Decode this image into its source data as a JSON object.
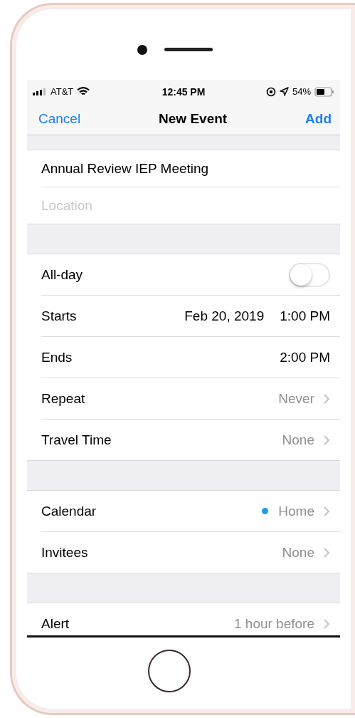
{
  "status_bar": {
    "carrier": "AT&T",
    "time": "12:45 PM",
    "battery": "54%"
  },
  "nav": {
    "cancel": "Cancel",
    "title": "New Event",
    "add": "Add"
  },
  "sections": [
    {
      "rows": [
        {
          "kind": "field",
          "value": "Annual Review IEP Meeting"
        },
        {
          "kind": "field",
          "placeholder": "Location"
        }
      ]
    },
    {
      "rows": [
        {
          "kind": "toggle",
          "label": "All-day",
          "on": false
        },
        {
          "kind": "datetime",
          "label": "Starts",
          "date": "Feb 20, 2019",
          "time": "1:00 PM"
        },
        {
          "kind": "datetime",
          "label": "Ends",
          "time": "2:00 PM"
        },
        {
          "kind": "disclosure",
          "label": "Repeat",
          "value": "Never"
        },
        {
          "kind": "disclosure",
          "label": "Travel Time",
          "value": "None"
        }
      ]
    },
    {
      "rows": [
        {
          "kind": "disclosure",
          "label": "Calendar",
          "value": "Home",
          "color": "#1a9ff0"
        },
        {
          "kind": "disclosure",
          "label": "Invitees",
          "value": "None"
        }
      ]
    },
    {
      "rows": [
        {
          "kind": "disclosure",
          "label": "Alert",
          "value": "1 hour before"
        }
      ]
    }
  ]
}
